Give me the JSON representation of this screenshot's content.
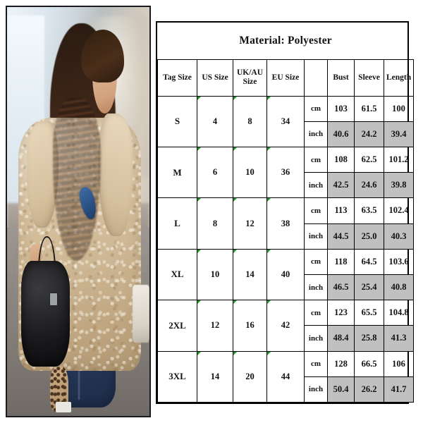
{
  "product_photo": {
    "alt": "Woman wearing beige teddy sherpa long coat with gray top, blue jeans, black leather handbag and leopard print shoes",
    "garment_color": "#d3bb98",
    "top_color": "#9ba2ab",
    "jeans_color": "#2f4569",
    "bag_color": "#1a1a1d"
  },
  "table": {
    "title": "Material: Polyester",
    "headers": {
      "tag_size": "Tag Size",
      "us_size": "US Size",
      "uk_au_size_line1": "UK/AU",
      "uk_au_size_line2": "Size",
      "eu_size": "EU Size",
      "unit": "",
      "bust": "Bust",
      "sleeve": "Sleeve",
      "length": "Length"
    },
    "units": {
      "cm": "cm",
      "inch": "inch"
    },
    "inch_row_background": "#c0c0c0",
    "rows": [
      {
        "tag_size": "S",
        "us_size": "4",
        "uk_au_size": "8",
        "eu_size": "34",
        "cm": {
          "bust": "103",
          "sleeve": "61.5",
          "length": "100"
        },
        "inch": {
          "bust": "40.6",
          "sleeve": "24.2",
          "length": "39.4"
        }
      },
      {
        "tag_size": "M",
        "us_size": "6",
        "uk_au_size": "10",
        "eu_size": "36",
        "cm": {
          "bust": "108",
          "sleeve": "62.5",
          "length": "101.2"
        },
        "inch": {
          "bust": "42.5",
          "sleeve": "24.6",
          "length": "39.8"
        }
      },
      {
        "tag_size": "L",
        "us_size": "8",
        "uk_au_size": "12",
        "eu_size": "38",
        "cm": {
          "bust": "113",
          "sleeve": "63.5",
          "length": "102.4"
        },
        "inch": {
          "bust": "44.5",
          "sleeve": "25.0",
          "length": "40.3"
        }
      },
      {
        "tag_size": "XL",
        "us_size": "10",
        "uk_au_size": "14",
        "eu_size": "40",
        "cm": {
          "bust": "118",
          "sleeve": "64.5",
          "length": "103.6"
        },
        "inch": {
          "bust": "46.5",
          "sleeve": "25.4",
          "length": "40.8"
        }
      },
      {
        "tag_size": "2XL",
        "us_size": "12",
        "uk_au_size": "16",
        "eu_size": "42",
        "cm": {
          "bust": "123",
          "sleeve": "65.5",
          "length": "104.8"
        },
        "inch": {
          "bust": "48.4",
          "sleeve": "25.8",
          "length": "41.3"
        }
      },
      {
        "tag_size": "3XL",
        "us_size": "14",
        "uk_au_size": "20",
        "eu_size": "44",
        "cm": {
          "bust": "128",
          "sleeve": "66.5",
          "length": "106"
        },
        "inch": {
          "bust": "50.4",
          "sleeve": "26.2",
          "length": "41.7"
        }
      }
    ]
  }
}
